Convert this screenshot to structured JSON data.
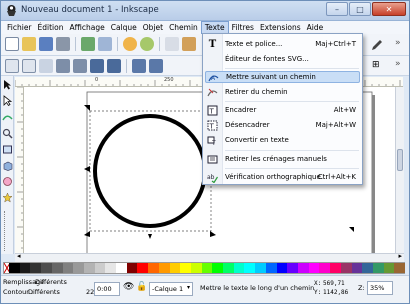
{
  "window": {
    "title": "Nouveau document 1 - Inkscape",
    "controls": {
      "minimize": "–",
      "maximize": "□",
      "close": "✕"
    }
  },
  "menubar": {
    "items": [
      {
        "label": "Fichier"
      },
      {
        "label": "Édition"
      },
      {
        "label": "Affichage"
      },
      {
        "label": "Calque"
      },
      {
        "label": "Objet"
      },
      {
        "label": "Chemin"
      },
      {
        "label": "Texte"
      },
      {
        "label": "Filtres"
      },
      {
        "label": "Extensions"
      },
      {
        "label": "Aide"
      }
    ],
    "active": "Texte"
  },
  "text_menu": {
    "items": [
      {
        "label": "Texte et police...",
        "shortcut": "Maj+Ctrl+T",
        "icon": "text-T-icon"
      },
      {
        "label": "Éditeur de fontes SVG...",
        "shortcut": "",
        "icon": ""
      },
      {
        "label": "Mettre suivant un chemin",
        "shortcut": "",
        "icon": "text-on-path-icon"
      },
      {
        "label": "Retirer du chemin",
        "shortcut": "",
        "icon": "remove-from-path-icon"
      },
      {
        "label": "Encadrer",
        "shortcut": "Alt+W",
        "icon": "flow-into-frame-icon"
      },
      {
        "label": "Désencadrer",
        "shortcut": "Maj+Alt+W",
        "icon": "unflow-icon"
      },
      {
        "label": "Convertir en texte",
        "shortcut": "",
        "icon": "convert-to-text-icon"
      },
      {
        "label": "Retirer les crénages manuels",
        "shortcut": "",
        "icon": "remove-kerns-icon"
      },
      {
        "label": "Vérification orthographique...",
        "shortcut": "Ctrl+Alt+K",
        "icon": "spellcheck-icon"
      }
    ],
    "highlighted": "Mettre suivant un chemin"
  },
  "rulers": {
    "top_ticks": [
      "0",
      "250"
    ]
  },
  "statusbar": {
    "fill_label": "Remplissage :",
    "fill_value": "Différents",
    "stroke_label": "Contour :",
    "stroke_value": "Différents",
    "stroke_width": "22",
    "opacity": "0:00",
    "layer": "-Calque 1",
    "message": "Mettre le texte le long d'un chemin",
    "x_label": "X:",
    "x_value": "569,71",
    "y_label": "Y:",
    "y_value": "1142,86",
    "zoom_label": "Z:",
    "zoom_value": "35%"
  },
  "palette": {
    "colors": [
      "#000000",
      "#1a1a1a",
      "#333333",
      "#4d4d4d",
      "#666666",
      "#808080",
      "#999999",
      "#b3b3b3",
      "#cccccc",
      "#e6e6e6",
      "#ffffff",
      "#800000",
      "#ff0000",
      "#ff6600",
      "#ff9900",
      "#ffcc00",
      "#ffff00",
      "#ccff00",
      "#66ff00",
      "#00ff00",
      "#00ff66",
      "#00ffcc",
      "#00ffff",
      "#00ccff",
      "#0066ff",
      "#0000ff",
      "#6600ff",
      "#cc00ff",
      "#ff00ff",
      "#ff00cc",
      "#ff0066",
      "#993366",
      "#663399",
      "#336699",
      "#339966",
      "#669933",
      "#996633"
    ]
  },
  "colors": {
    "menu_highlight": "#c9def6",
    "titlebar": "#cfdff2",
    "close": "#c7402a"
  }
}
